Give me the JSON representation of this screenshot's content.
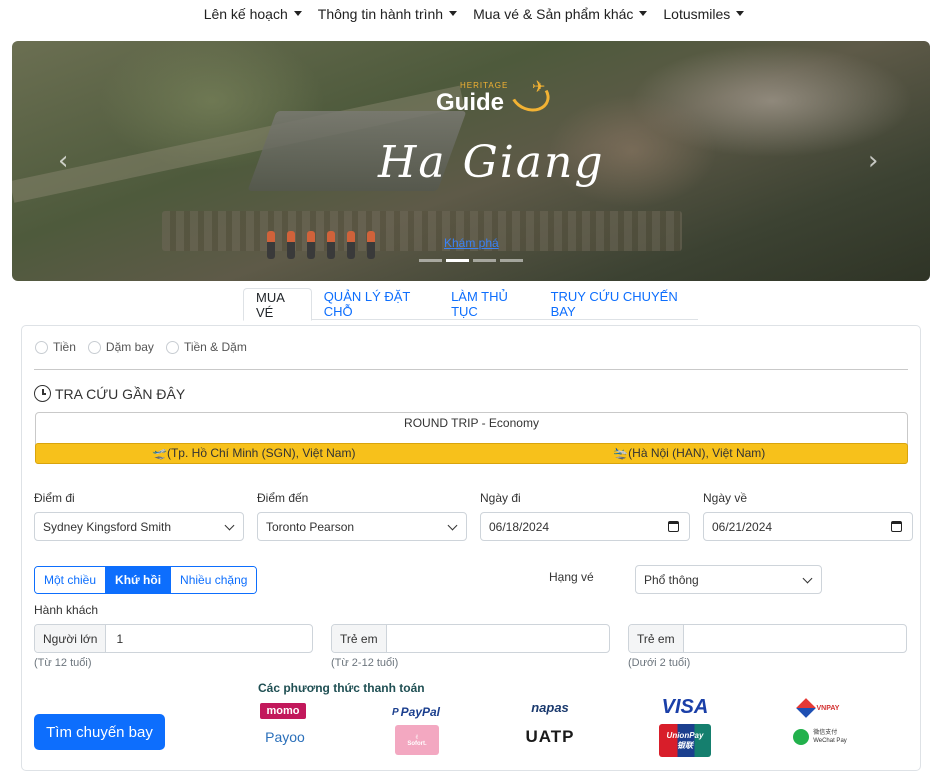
{
  "nav": {
    "items": [
      "Lên kế hoạch",
      "Thông tin hành trình",
      "Mua vé & Sản phẩm khác",
      "Lotusmiles"
    ]
  },
  "hero": {
    "logo_small": "HERITAGE",
    "logo": "Guide",
    "title": "Ha Giang",
    "cta": "Khám phá",
    "slides": 4,
    "active_slide": 2
  },
  "tabs": [
    {
      "label": "MUA VÉ",
      "active": true
    },
    {
      "label": "QUẢN LÝ ĐẶT CHỖ",
      "active": false
    },
    {
      "label": "LÀM THỦ TỤC",
      "active": false
    },
    {
      "label": "TRUY CỨU CHUYẾN BAY",
      "active": false
    }
  ],
  "payment_mode": {
    "options": [
      "Tiền",
      "Dặm bay",
      "Tiền & Dặm"
    ]
  },
  "recent": {
    "heading": "TRA CỨU GẦN ĐÂY",
    "trip": "ROUND TRIP - Economy",
    "from": "(Tp. Hồ Chí Minh (SGN), Việt Nam)",
    "to": "(Hà Nội (HAN), Việt Nam)"
  },
  "form": {
    "origin_label": "Điểm đi",
    "origin_value": "Sydney Kingsford Smith",
    "dest_label": "Điểm đến",
    "dest_value": "Toronto Pearson",
    "depart_label": "Ngày đi",
    "depart_value": "06/18/2024",
    "return_label": "Ngày về",
    "return_value": "06/21/2024",
    "trip_types": [
      "Một chiều",
      "Khứ hồi",
      "Nhiều chặng"
    ],
    "trip_type_active": "Khứ hồi",
    "class_label": "Hạng vé",
    "class_value": "Phổ thông",
    "passengers_label": "Hành khách",
    "adult_label": "Người lớn",
    "adult_value": "1",
    "adult_hint": "(Từ 12 tuổi)",
    "child_label": "Trẻ em",
    "child_value": "",
    "child_hint": "(Từ 2-12 tuổi)",
    "infant_label": "Trẻ em",
    "infant_value": "",
    "infant_hint": "(Dưới 2 tuổi)",
    "search_button": "Tìm chuyến bay"
  },
  "payments": {
    "title": "Các phương thức thanh toán",
    "momo": "momo",
    "paypal": "PayPal",
    "napas": "napas",
    "visa": "VISA",
    "vnpay": "VNPAY",
    "payoo": "Payoo",
    "sofort": "Sofort.",
    "uatp": "UATP",
    "unionpay": "UnionPay",
    "unionpay_cn": "银联",
    "wechat": "微信支付",
    "wechat_en": "WeChat Pay"
  },
  "colors": {
    "primary": "#0d6efd",
    "route_bar": "#f7c11b",
    "payment_title": "#1f4f53"
  }
}
